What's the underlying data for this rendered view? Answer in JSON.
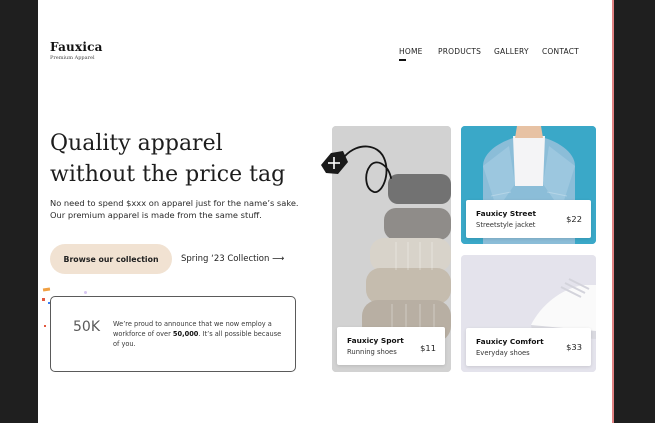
{
  "brand": {
    "name": "Fauxica",
    "tagline": "Premium Apparel"
  },
  "nav": {
    "items": [
      {
        "label": "HOME",
        "active": true
      },
      {
        "label": "PRODUCTS",
        "active": false
      },
      {
        "label": "GALLERY",
        "active": false
      },
      {
        "label": "CONTACT",
        "active": false
      }
    ]
  },
  "hero": {
    "title_line1": "Quality apparel",
    "title_line2": "without the price tag",
    "desc_line1": "No need to spend $xxx on apparel just for the name’s sake.",
    "desc_line2": "Our premium apparel is made from the same stuff.",
    "cta_label": "Browse our collection",
    "collection_link": "Spring ‘23 Collection ⟶"
  },
  "stat": {
    "number": "50K",
    "text_before": "We’re proud to announce that we now employ a workforce of over ",
    "text_bold": "50,000",
    "text_after": ". It’s all possible because of you."
  },
  "products": [
    {
      "name": "Fauxicy Sport",
      "subtitle": "Running shoes",
      "price": "$11"
    },
    {
      "name": "Fauxicy Street",
      "subtitle": "Streetstyle jacket",
      "price": "$22"
    },
    {
      "name": "Fauxicy Comfort",
      "subtitle": "Everyday shoes",
      "price": "$33"
    }
  ],
  "colors": {
    "cta_bg": "#f1e2d2",
    "denim_bg": "#3fa9c8",
    "accent_confetti": [
      "#e2583e",
      "#6a4dd6",
      "#f0a043",
      "#3c7ef0"
    ]
  },
  "icons": {
    "tag": "price-tag-icon",
    "arrow": "arrow-right-icon"
  }
}
